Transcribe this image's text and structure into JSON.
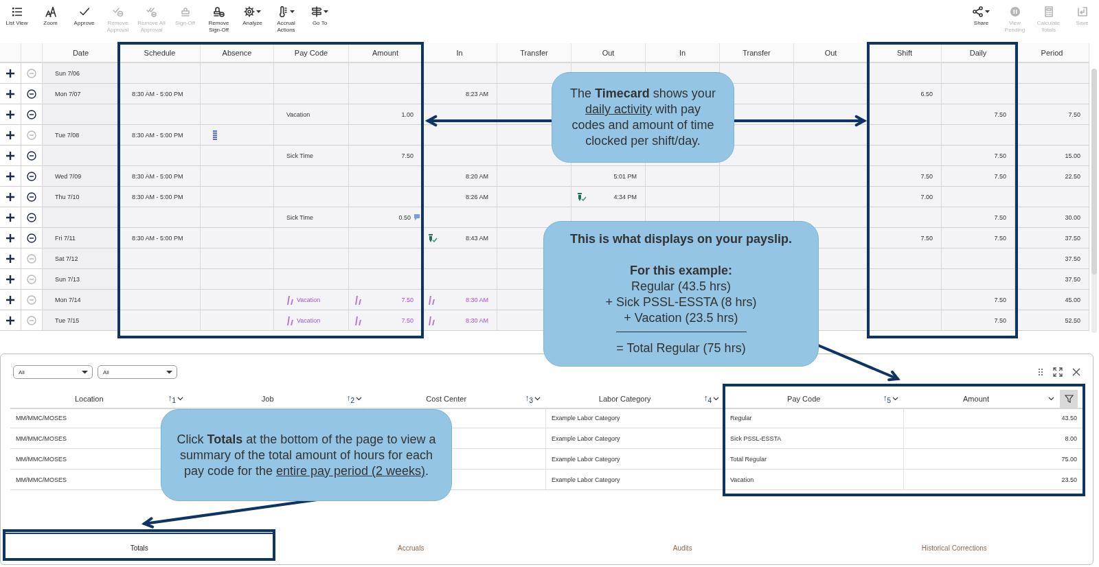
{
  "toolbar": {
    "left": [
      {
        "label": "List View",
        "disabled": false,
        "has_menu": false
      },
      {
        "label": "Zoom",
        "disabled": false,
        "has_menu": false
      },
      {
        "label": "Approve",
        "disabled": false,
        "has_menu": false
      },
      {
        "label": "Remove Approval",
        "disabled": true,
        "has_menu": false
      },
      {
        "label": "Remove All Approval",
        "disabled": true,
        "has_menu": false
      },
      {
        "label": "Sign-Off",
        "disabled": true,
        "has_menu": false
      },
      {
        "label": "Remove Sign-Off",
        "disabled": false,
        "has_menu": false
      },
      {
        "label": "Analyze",
        "disabled": false,
        "has_menu": true
      },
      {
        "label": "Accrual Actions",
        "disabled": false,
        "has_menu": true
      },
      {
        "label": "Go To",
        "disabled": false,
        "has_menu": true
      }
    ],
    "right": [
      {
        "label": "Share",
        "disabled": false,
        "has_menu": true
      },
      {
        "label": "View Pending",
        "disabled": true,
        "has_menu": false
      },
      {
        "label": "Calculate Totals",
        "disabled": true,
        "has_menu": false
      },
      {
        "label": "Save",
        "disabled": true,
        "has_menu": false
      }
    ]
  },
  "timecard": {
    "columns": [
      "Date",
      "Schedule",
      "Absence",
      "Pay Code",
      "Amount",
      "In",
      "Transfer",
      "Out",
      "In",
      "Transfer",
      "Out",
      "Shift",
      "Daily",
      "Period"
    ],
    "rows": [
      {
        "date": "Sun 7/06",
        "removable": false,
        "projected": false,
        "absence_marked": false,
        "amount_noted": false,
        "in_verified": false,
        "out_verified": false
      },
      {
        "date": "Mon 7/07",
        "schedule": "8:30 AM - 5:00 PM",
        "in_1": "8:23 AM",
        "shift": "6.50",
        "removable": true,
        "projected": false,
        "absence_marked": false,
        "amount_noted": false,
        "in_verified": false,
        "out_verified": false
      },
      {
        "pay_code": "Vacation",
        "amount": "1.00",
        "daily": "7.50",
        "period": "7.50",
        "removable": true,
        "projected": false,
        "absence_marked": false,
        "amount_noted": false,
        "in_verified": false,
        "out_verified": false
      },
      {
        "date": "Tue 7/08",
        "schedule": "8:30 AM - 5:00 PM",
        "removable": false,
        "projected": false,
        "absence_marked": true,
        "amount_noted": false,
        "in_verified": false,
        "out_verified": false
      },
      {
        "pay_code": "Sick Time",
        "amount": "7.50",
        "daily": "7.50",
        "period": "15.00",
        "removable": true,
        "projected": false,
        "absence_marked": false,
        "amount_noted": false,
        "in_verified": false,
        "out_verified": false
      },
      {
        "date": "Wed 7/09",
        "schedule": "8:30 AM - 5:00 PM",
        "in_1": "8:20 AM",
        "out_1": "5:01 PM",
        "shift": "7.50",
        "daily": "7.50",
        "period": "22.50",
        "removable": true,
        "projected": false,
        "absence_marked": false,
        "amount_noted": false,
        "in_verified": false,
        "out_verified": false
      },
      {
        "date": "Thu 7/10",
        "schedule": "8:30 AM - 5:00 PM",
        "in_1": "8:26 AM",
        "out_1": "4:34 PM",
        "shift": "7.00",
        "removable": true,
        "projected": false,
        "absence_marked": false,
        "amount_noted": false,
        "in_verified": false,
        "out_verified": true
      },
      {
        "pay_code": "Sick Time",
        "amount": "0.50",
        "daily": "7.50",
        "period": "30.00",
        "removable": true,
        "projected": false,
        "absence_marked": false,
        "amount_noted": true,
        "in_verified": false,
        "out_verified": false
      },
      {
        "date": "Fri 7/11",
        "schedule": "8:30 AM - 5:00 PM",
        "in_1": "8:43 AM",
        "shift": "7.50",
        "daily": "7.50",
        "period": "37.50",
        "removable": true,
        "projected": false,
        "absence_marked": false,
        "amount_noted": false,
        "in_verified": true,
        "out_verified": false
      },
      {
        "date": "Sat 7/12",
        "period": "37.50",
        "removable": false,
        "projected": false,
        "absence_marked": false,
        "amount_noted": false,
        "in_verified": false,
        "out_verified": false
      },
      {
        "date": "Sun 7/13",
        "period": "37.50",
        "removable": false,
        "projected": false,
        "absence_marked": false,
        "amount_noted": false,
        "in_verified": false,
        "out_verified": false
      },
      {
        "date": "Mon 7/14",
        "pay_code": "Vacation",
        "amount": "7.50",
        "in_1": "8:30 AM",
        "daily": "7.50",
        "period": "45.00",
        "removable": false,
        "projected": true,
        "absence_marked": false,
        "amount_noted": false,
        "in_verified": false,
        "out_verified": false
      },
      {
        "date": "Tue 7/15",
        "pay_code": "Vacation",
        "amount": "7.50",
        "in_1": "8:30 AM",
        "daily": "7.50",
        "period": "52.50",
        "removable": false,
        "projected": true,
        "absence_marked": false,
        "amount_noted": false,
        "in_verified": false,
        "out_verified": false
      }
    ]
  },
  "totals_panel": {
    "filters": [
      "All",
      "All"
    ],
    "columns": [
      {
        "label": "Location",
        "sort": "↑$_{1}$",
        "filter": false
      },
      {
        "label": "Job",
        "sort": "↑$_{2}$",
        "filter": false
      },
      {
        "label": "Cost Center",
        "sort": "↑$_{3}$",
        "filter": false
      },
      {
        "label": "Labor Category",
        "sort": "↑$_{4}$",
        "filter": false
      },
      {
        "label": "Pay Code",
        "sort": "↑$_{5}$",
        "filter": false
      },
      {
        "label": "Amount",
        "filter": true
      }
    ],
    "rows": [
      {
        "location": "MM/MMC/MOSES",
        "labor_category": "Example Labor Category",
        "pay_code": "Regular",
        "amount": "43.50"
      },
      {
        "location": "MM/MMC/MOSES",
        "labor_category": "Example Labor Category",
        "pay_code": "Sick PSSL-ESSTA",
        "amount": "8.00"
      },
      {
        "location": "MM/MMC/MOSES",
        "labor_category": "Example Labor Category",
        "pay_code": "Total Regular",
        "amount": "75.00"
      },
      {
        "location": "MM/MMC/MOSES",
        "labor_category": "Example Labor Category",
        "pay_code": "Vacation",
        "amount": "23.50"
      }
    ],
    "tabs": [
      {
        "label": "Totals",
        "selected": true
      },
      {
        "label": "Accruals",
        "selected": false
      },
      {
        "label": "Audits",
        "selected": false
      },
      {
        "label": "Historical Corrections",
        "selected": false
      }
    ]
  },
  "callouts": [
    {
      "kind": "paragraph",
      "parts": [
        {
          "text": "The ",
          "kind": "plain"
        },
        {
          "text": "Timecard",
          "kind": "bold"
        },
        {
          "text": " shows your ",
          "kind": "plain"
        },
        {
          "text": "daily activity",
          "kind": "underline"
        },
        {
          "text": " with pay codes and amount of time clocked per shift/day.",
          "kind": "plain"
        }
      ]
    },
    {
      "kind": "list",
      "lines": [
        {
          "kind": "heading",
          "text": "This is what displays on your payslip."
        },
        {
          "kind": "heading",
          "text": "For this example:"
        },
        {
          "kind": "text",
          "text": "Regular (43.5 hrs)"
        },
        {
          "kind": "text",
          "text": "+ Sick PSSL-ESSTA (8 hrs)"
        },
        {
          "kind": "text",
          "text": "+ Vacation (23.5 hrs)"
        },
        {
          "kind": "rule"
        },
        {
          "kind": "text",
          "text": "= Total Regular (75 hrs)"
        }
      ]
    },
    {
      "kind": "paragraph",
      "parts": [
        {
          "text": "Click ",
          "kind": "plain"
        },
        {
          "text": "Totals",
          "kind": "bold"
        },
        {
          "text": " at the bottom of the page to view a summary of the total amount of hours for each pay code for the ",
          "kind": "plain"
        },
        {
          "text": "entire pay period (2 weeks)",
          "kind": "underline"
        },
        {
          "text": ".",
          "kind": "plain"
        }
      ]
    }
  ]
}
